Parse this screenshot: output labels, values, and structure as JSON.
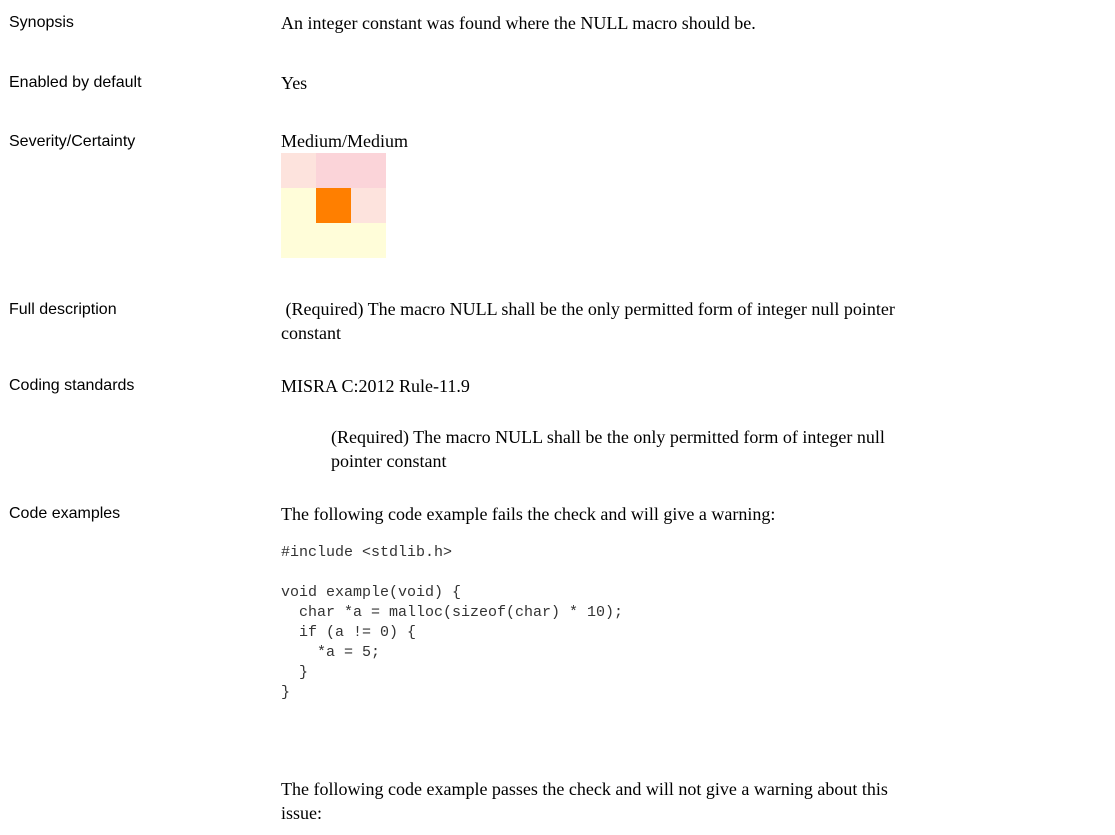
{
  "synopsis": {
    "label": "Synopsis",
    "value": "An integer constant was found where the NULL macro should be."
  },
  "enabled": {
    "label": "Enabled by default",
    "value": "Yes"
  },
  "severity": {
    "label": "Severity/Certainty",
    "value": "Medium/Medium",
    "matrix": {
      "severity_level": "Medium",
      "certainty_level": "Medium",
      "colors": [
        [
          "#fde3dd",
          "#fbd4d9",
          "#fbd4d9"
        ],
        [
          "#fffdd9",
          "#ff7f00",
          "#fde3dd"
        ],
        [
          "#fffdd9",
          "#fffdd9",
          "#fffdd9"
        ]
      ]
    }
  },
  "full_description": {
    "label": "Full description",
    "line1": " (Required) The macro NULL shall be the only permitted form of integer null pointer",
    "line2": "constant"
  },
  "coding_standards": {
    "label": "Coding standards",
    "standard": "MISRA C:2012 Rule-11.9",
    "desc_line1": "(Required) The macro NULL shall be the only permitted form of integer null",
    "desc_line2": "pointer constant"
  },
  "code_examples": {
    "label": "Code examples",
    "fail_intro": "The following code example fails the check and will give a warning:",
    "fail_code": "#include <stdlib.h>\n\nvoid example(void) {\n  char *a = malloc(sizeof(char) * 10);\n  if (a != 0) {\n    *a = 5;\n  }\n}",
    "pass_intro_line1": "The following code example passes the check and will not give a warning about this",
    "pass_intro_line2": "issue:"
  }
}
